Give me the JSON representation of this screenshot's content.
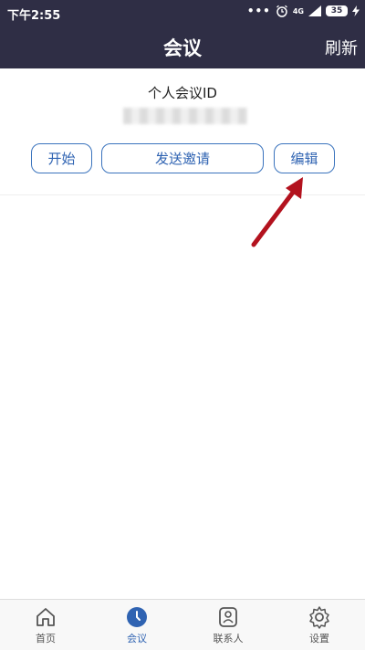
{
  "status_bar": {
    "time": "下午2:55",
    "network": "4G",
    "battery": "35"
  },
  "header": {
    "title": "会议",
    "refresh_label": "刷新"
  },
  "meeting": {
    "pmi_label": "个人会议ID",
    "pmi_value_blurred": "••••••••••",
    "start_label": "开始",
    "invite_label": "发送邀请",
    "edit_label": "编辑"
  },
  "tabs": [
    {
      "label": "首页",
      "icon": "home-icon",
      "active": false
    },
    {
      "label": "会议",
      "icon": "clock-icon",
      "active": true
    },
    {
      "label": "联系人",
      "icon": "contact-icon",
      "active": false
    },
    {
      "label": "设置",
      "icon": "gear-icon",
      "active": false
    }
  ],
  "colors": {
    "header_bg": "#2f2e45",
    "accent": "#2f63b2",
    "annotation_arrow": "#b3121e"
  }
}
